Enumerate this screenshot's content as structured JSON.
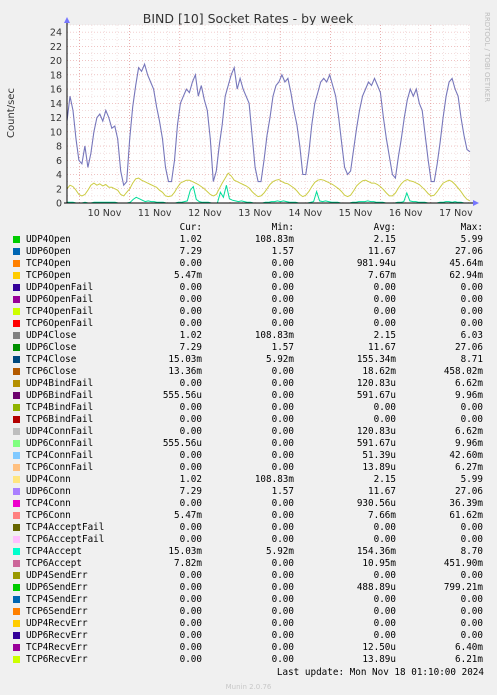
{
  "chart_data": {
    "type": "line",
    "title": "BIND [10] Socket Rates - by week",
    "ylabel": "Count/sec",
    "xlabel": "",
    "ylim": [
      0,
      25
    ],
    "yticks": [
      0,
      2,
      4,
      6,
      8,
      10,
      12,
      14,
      16,
      18,
      20,
      22,
      24
    ],
    "xticks": [
      "10 Nov",
      "11 Nov",
      "12 Nov",
      "13 Nov",
      "14 Nov",
      "15 Nov",
      "16 Nov",
      "17 Nov"
    ],
    "grid": true,
    "side_label": "RRDTOOL / TOBI OETIKER",
    "series_colors": {
      "tcp4_close": "#7777bb",
      "udp6": "#cccc44",
      "tcp4_accept": "#00dd99"
    },
    "series": [
      {
        "name": "TCP4Close",
        "values": [
          11.5,
          15,
          13,
          9,
          6,
          5.5,
          8,
          5,
          7,
          10,
          12,
          12.5,
          11.5,
          13,
          12,
          10.5,
          10.8,
          9,
          4.5,
          2.5,
          3,
          9,
          13.5,
          16.5,
          19,
          18.5,
          19.5,
          18,
          17,
          16,
          13.5,
          11.5,
          9,
          5,
          3,
          3,
          6,
          11,
          14,
          15,
          16,
          15.5,
          17,
          18,
          15,
          16.5,
          14.5,
          13,
          9,
          3,
          4.5,
          8,
          11,
          15,
          16.5,
          18,
          19,
          16,
          17.5,
          16,
          15,
          14,
          9.5,
          5,
          3,
          3,
          6,
          9.5,
          12,
          15,
          16.5,
          17,
          18,
          17,
          17.5,
          15.5,
          13,
          11,
          8,
          4,
          4,
          7,
          11,
          14,
          15.5,
          17,
          17.5,
          17,
          18,
          16.5,
          15,
          12,
          8.5,
          5,
          4,
          4.5,
          7.5,
          10.5,
          13,
          15,
          16,
          17,
          16.5,
          17.5,
          16.5,
          15.5,
          12,
          9,
          6.5,
          4,
          3.5,
          6.5,
          9,
          12,
          14.5,
          16,
          15,
          16,
          14,
          13,
          9.5,
          6,
          3,
          3,
          5.5,
          8.5,
          12,
          15,
          17,
          17.5,
          16,
          15,
          12,
          9.5,
          7.5,
          7.2
        ]
      },
      {
        "name": "UDP6",
        "values": [
          2,
          2.5,
          2.3,
          1.8,
          1.2,
          1,
          1.2,
          1.8,
          2.5,
          2.8,
          2.5,
          2.7,
          2.4,
          2.6,
          2.2,
          2.2,
          2,
          1.8,
          1.2,
          1,
          1.5,
          2,
          2.8,
          3.4,
          3.5,
          3.2,
          3,
          2.8,
          2.6,
          2.4,
          2.2,
          1.8,
          1.5,
          1,
          0.9,
          1,
          1.5,
          2.2,
          2.8,
          3,
          3.2,
          3.2,
          3,
          2.8,
          2.6,
          2.3,
          2,
          1.6,
          1.2,
          1,
          1.2,
          2,
          2.8,
          3.5,
          4.2,
          3.8,
          3.2,
          3,
          2.8,
          2.6,
          2.4,
          2.1,
          1.6,
          1.2,
          0.9,
          1,
          1.4,
          2,
          2.6,
          3,
          3.2,
          3.3,
          3,
          2.8,
          2.7,
          2.4,
          2.1,
          1.7,
          1.2,
          0.9,
          1.1,
          1.6,
          2.3,
          2.9,
          3.2,
          3.3,
          3.2,
          3,
          2.8,
          2.6,
          2.3,
          2,
          1.6,
          1.1,
          0.9,
          1.1,
          1.7,
          2.4,
          2.8,
          3.1,
          3.2,
          3,
          2.8,
          2.8,
          2.6,
          2.3,
          1.9,
          1.4,
          1,
          1,
          1.4,
          2.1,
          2.7,
          3.1,
          3.3,
          3.1,
          3,
          2.8,
          2.6,
          2.2,
          1.8,
          1.3,
          1,
          1.1,
          1.6,
          2.2,
          2.8,
          3,
          3.2,
          3,
          2.6,
          2.1,
          1.6,
          1,
          0.5,
          0.3
        ]
      },
      {
        "name": "TCP4Accept",
        "values": [
          0.1,
          0.1,
          0.1,
          0,
          0,
          0,
          0.1,
          0,
          0,
          0.1,
          0.1,
          0.1,
          0.1,
          0.1,
          0.1,
          0.1,
          0.1,
          0,
          0,
          0,
          0,
          0.1,
          0.5,
          0.8,
          0.6,
          0.4,
          0.2,
          0.3,
          0.2,
          0.2,
          0.1,
          0.1,
          0.1,
          0,
          0,
          0,
          0,
          0.1,
          0.1,
          0.2,
          0.3,
          1.8,
          2.3,
          0.5,
          0.2,
          0.1,
          0.1,
          0.1,
          0,
          0,
          0,
          1.5,
          0.8,
          2.5,
          0.6,
          0.4,
          0.3,
          0.2,
          0.3,
          0.2,
          0.1,
          0.1,
          0,
          0,
          0,
          0,
          0.1,
          0.1,
          0.2,
          0.2,
          0.3,
          0.2,
          0.3,
          0.2,
          0.1,
          0.1,
          0.1,
          0,
          0,
          0,
          0,
          0.1,
          0.2,
          1.6,
          0.3,
          0.2,
          0.3,
          0.2,
          0.1,
          0.1,
          0.1,
          0,
          0,
          0,
          0,
          0.1,
          0.1,
          0.2,
          0.2,
          0.2,
          0.3,
          0.2,
          0.2,
          0.1,
          0.1,
          0.1,
          0,
          0,
          0,
          0,
          0.1,
          0.1,
          0.2,
          1.4,
          0.3,
          0.2,
          0.2,
          0.1,
          0.1,
          0.1,
          0,
          0,
          0,
          0,
          0.1,
          0.1,
          0.2,
          0.2,
          0.1,
          0.2,
          0.1,
          0.1,
          0,
          0,
          0
        ]
      }
    ]
  },
  "legend": {
    "headers": [
      "Cur:",
      "Min:",
      "Avg:",
      "Max:"
    ],
    "rows": [
      {
        "name": "UDP4Open",
        "color": "#00cc00",
        "cur": "1.02",
        "min": "108.83m",
        "avg": "2.15",
        "max": "5.99"
      },
      {
        "name": "UDP6Open",
        "color": "#0066b3",
        "cur": "7.29",
        "min": "1.57",
        "avg": "11.67",
        "max": "27.06"
      },
      {
        "name": "TCP4Open",
        "color": "#ff8000",
        "cur": "0.00",
        "min": "0.00",
        "avg": "981.94u",
        "max": "45.64m"
      },
      {
        "name": "TCP6Open",
        "color": "#ffcc00",
        "cur": "5.47m",
        "min": "0.00",
        "avg": "7.67m",
        "max": "62.94m"
      },
      {
        "name": "UDP4OpenFail",
        "color": "#330099",
        "cur": "0.00",
        "min": "0.00",
        "avg": "0.00",
        "max": "0.00"
      },
      {
        "name": "UDP6OpenFail",
        "color": "#990099",
        "cur": "0.00",
        "min": "0.00",
        "avg": "0.00",
        "max": "0.00"
      },
      {
        "name": "TCP4OpenFail",
        "color": "#ccff00",
        "cur": "0.00",
        "min": "0.00",
        "avg": "0.00",
        "max": "0.00"
      },
      {
        "name": "TCP6OpenFail",
        "color": "#ff0000",
        "cur": "0.00",
        "min": "0.00",
        "avg": "0.00",
        "max": "0.00"
      },
      {
        "name": "UDP4Close",
        "color": "#808080",
        "cur": "1.02",
        "min": "108.83m",
        "avg": "2.15",
        "max": "6.03"
      },
      {
        "name": "UDP6Close",
        "color": "#008f00",
        "cur": "7.29",
        "min": "1.57",
        "avg": "11.67",
        "max": "27.06"
      },
      {
        "name": "TCP4Close",
        "color": "#00487d",
        "cur": "15.03m",
        "min": "5.92m",
        "avg": "155.34m",
        "max": "8.71"
      },
      {
        "name": "TCP6Close",
        "color": "#b35a00",
        "cur": "13.36m",
        "min": "0.00",
        "avg": "18.62m",
        "max": "458.02m"
      },
      {
        "name": "UDP4BindFail",
        "color": "#b38f00",
        "cur": "0.00",
        "min": "0.00",
        "avg": "120.83u",
        "max": "6.62m"
      },
      {
        "name": "UDP6BindFail",
        "color": "#6b006b",
        "cur": "555.56u",
        "min": "0.00",
        "avg": "591.67u",
        "max": "9.96m"
      },
      {
        "name": "TCP4BindFail",
        "color": "#8fb300",
        "cur": "0.00",
        "min": "0.00",
        "avg": "0.00",
        "max": "0.00"
      },
      {
        "name": "TCP6BindFail",
        "color": "#b30000",
        "cur": "0.00",
        "min": "0.00",
        "avg": "0.00",
        "max": "0.00"
      },
      {
        "name": "UDP4ConnFail",
        "color": "#bebebe",
        "cur": "0.00",
        "min": "0.00",
        "avg": "120.83u",
        "max": "6.62m"
      },
      {
        "name": "UDP6ConnFail",
        "color": "#80ff80",
        "cur": "555.56u",
        "min": "0.00",
        "avg": "591.67u",
        "max": "9.96m"
      },
      {
        "name": "TCP4ConnFail",
        "color": "#80c9ff",
        "cur": "0.00",
        "min": "0.00",
        "avg": "51.39u",
        "max": "42.60m"
      },
      {
        "name": "TCP6ConnFail",
        "color": "#ffc080",
        "cur": "0.00",
        "min": "0.00",
        "avg": "13.89u",
        "max": "6.27m"
      },
      {
        "name": "UDP4Conn",
        "color": "#ffe680",
        "cur": "1.02",
        "min": "108.83m",
        "avg": "2.15",
        "max": "5.99"
      },
      {
        "name": "UDP6Conn",
        "color": "#aa80ff",
        "cur": "7.29",
        "min": "1.57",
        "avg": "11.67",
        "max": "27.06"
      },
      {
        "name": "TCP4Conn",
        "color": "#ee00cc",
        "cur": "0.00",
        "min": "0.00",
        "avg": "930.56u",
        "max": "36.39m"
      },
      {
        "name": "TCP6Conn",
        "color": "#ff8080",
        "cur": "5.47m",
        "min": "0.00",
        "avg": "7.66m",
        "max": "61.62m"
      },
      {
        "name": "TCP4AcceptFail",
        "color": "#666600",
        "cur": "0.00",
        "min": "0.00",
        "avg": "0.00",
        "max": "0.00"
      },
      {
        "name": "TCP6AcceptFail",
        "color": "#ffbfff",
        "cur": "0.00",
        "min": "0.00",
        "avg": "0.00",
        "max": "0.00"
      },
      {
        "name": "TCP4Accept",
        "color": "#00ffcc",
        "cur": "15.03m",
        "min": "5.92m",
        "avg": "154.36m",
        "max": "8.70"
      },
      {
        "name": "TCP6Accept",
        "color": "#cc6699",
        "cur": "7.82m",
        "min": "0.00",
        "avg": "10.95m",
        "max": "451.90m"
      },
      {
        "name": "UDP4SendErr",
        "color": "#999900",
        "cur": "0.00",
        "min": "0.00",
        "avg": "0.00",
        "max": "0.00"
      },
      {
        "name": "UDP6SendErr",
        "color": "#00cc00",
        "cur": "0.00",
        "min": "0.00",
        "avg": "488.89u",
        "max": "799.21m"
      },
      {
        "name": "TCP4SendErr",
        "color": "#0066b3",
        "cur": "0.00",
        "min": "0.00",
        "avg": "0.00",
        "max": "0.00"
      },
      {
        "name": "TCP6SendErr",
        "color": "#ff8000",
        "cur": "0.00",
        "min": "0.00",
        "avg": "0.00",
        "max": "0.00"
      },
      {
        "name": "UDP4RecvErr",
        "color": "#ffcc00",
        "cur": "0.00",
        "min": "0.00",
        "avg": "0.00",
        "max": "0.00"
      },
      {
        "name": "UDP6RecvErr",
        "color": "#330099",
        "cur": "0.00",
        "min": "0.00",
        "avg": "0.00",
        "max": "0.00"
      },
      {
        "name": "TCP4RecvErr",
        "color": "#990099",
        "cur": "0.00",
        "min": "0.00",
        "avg": "12.50u",
        "max": "6.40m"
      },
      {
        "name": "TCP6RecvErr",
        "color": "#ccff00",
        "cur": "0.00",
        "min": "0.00",
        "avg": "13.89u",
        "max": "6.21m"
      }
    ]
  },
  "footer": {
    "last_update": "Last update: Mon Nov 18 01:10:00 2024",
    "munin": "Munin 2.0.76"
  }
}
